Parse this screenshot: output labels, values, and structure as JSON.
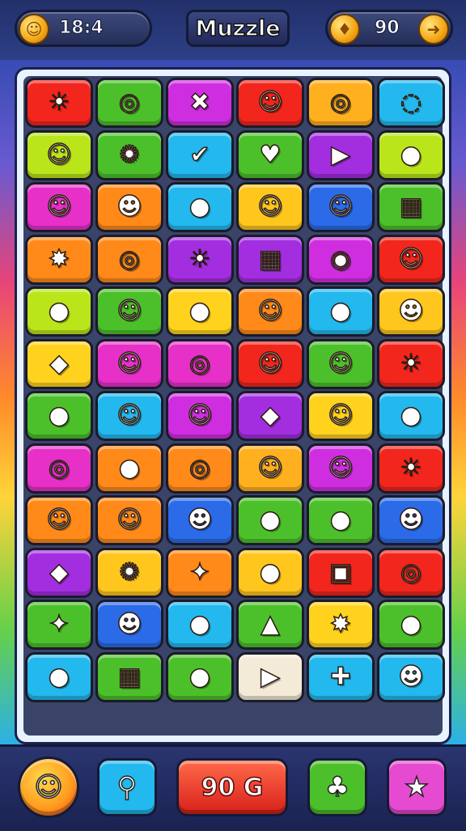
{
  "header": {
    "left_counter": "18:4",
    "title": "Muzzle",
    "right_counter": "90"
  },
  "board": {
    "rows": [
      [
        {
          "c": "#f2261d",
          "g": "☀"
        },
        {
          "c": "#4cc02a",
          "g": "◎"
        },
        {
          "c": "#cf2ee0",
          "g": "✖"
        },
        {
          "c": "#f2261d",
          "g": "☺"
        },
        {
          "c": "#ffb01e",
          "g": "◎"
        },
        {
          "c": "#23b8ee",
          "g": "◌"
        }
      ],
      [
        {
          "c": "#b9e51a",
          "g": "☺"
        },
        {
          "c": "#4cc02a",
          "g": "✺"
        },
        {
          "c": "#23b8ee",
          "g": "✔"
        },
        {
          "c": "#4cc02a",
          "g": "♥"
        },
        {
          "c": "#a22ee0",
          "g": "▶"
        },
        {
          "c": "#b9e51a",
          "g": "●"
        }
      ],
      [
        {
          "c": "#e630c8",
          "g": "☺"
        },
        {
          "c": "#ff8a1a",
          "g": "☻"
        },
        {
          "c": "#23b8ee",
          "g": "●"
        },
        {
          "c": "#ffc61e",
          "g": "☺"
        },
        {
          "c": "#2b6be8",
          "g": "☺"
        },
        {
          "c": "#4cc02a",
          "g": "▦"
        }
      ],
      [
        {
          "c": "#ff8a1a",
          "g": "✸"
        },
        {
          "c": "#ff8a1a",
          "g": "◎"
        },
        {
          "c": "#a22ee0",
          "g": "☀"
        },
        {
          "c": "#a22ee0",
          "g": "▦"
        },
        {
          "c": "#cf2ee0",
          "g": "◉"
        },
        {
          "c": "#f2261d",
          "g": "☺"
        }
      ],
      [
        {
          "c": "#b9e51a",
          "g": "●"
        },
        {
          "c": "#4cc02a",
          "g": "☺"
        },
        {
          "c": "#ffd21e",
          "g": "●"
        },
        {
          "c": "#ff8a1a",
          "g": "☺"
        },
        {
          "c": "#23b8ee",
          "g": "●"
        },
        {
          "c": "#ffc61e",
          "g": "☻"
        }
      ],
      [
        {
          "c": "#ffd21e",
          "g": "◆"
        },
        {
          "c": "#e630c8",
          "g": "☺"
        },
        {
          "c": "#e630c8",
          "g": "◎"
        },
        {
          "c": "#f2261d",
          "g": "☺"
        },
        {
          "c": "#4cc02a",
          "g": "☺"
        },
        {
          "c": "#f2261d",
          "g": "☀"
        }
      ],
      [
        {
          "c": "#4cc02a",
          "g": "●"
        },
        {
          "c": "#23b8ee",
          "g": "☺"
        },
        {
          "c": "#cf2ee0",
          "g": "☺"
        },
        {
          "c": "#a22ee0",
          "g": "◆"
        },
        {
          "c": "#ffd21e",
          "g": "☺"
        },
        {
          "c": "#23b8ee",
          "g": "●"
        }
      ],
      [
        {
          "c": "#e630c8",
          "g": "◎"
        },
        {
          "c": "#ff8a1a",
          "g": "●"
        },
        {
          "c": "#ff8a1a",
          "g": "◎"
        },
        {
          "c": "#ffb01e",
          "g": "☺"
        },
        {
          "c": "#cf2ee0",
          "g": "☺"
        },
        {
          "c": "#f2261d",
          "g": "☀"
        }
      ],
      [
        {
          "c": "#ff8a1a",
          "g": "☺"
        },
        {
          "c": "#ff8a1a",
          "g": "☺"
        },
        {
          "c": "#2b6be8",
          "g": "☻"
        },
        {
          "c": "#4cc02a",
          "g": "●"
        },
        {
          "c": "#4cc02a",
          "g": "●"
        },
        {
          "c": "#2b6be8",
          "g": "☻"
        }
      ],
      [
        {
          "c": "#a22ee0",
          "g": "◆"
        },
        {
          "c": "#ffc61e",
          "g": "✺"
        },
        {
          "c": "#ff8a1a",
          "g": "✦"
        },
        {
          "c": "#ffc61e",
          "g": "●"
        },
        {
          "c": "#f2261d",
          "g": "▣"
        },
        {
          "c": "#f2261d",
          "g": "◎"
        }
      ],
      [
        {
          "c": "#4cc02a",
          "g": "✦"
        },
        {
          "c": "#2b6be8",
          "g": "☻"
        },
        {
          "c": "#23b8ee",
          "g": "●"
        },
        {
          "c": "#4cc02a",
          "g": "▲"
        },
        {
          "c": "#ffd21e",
          "g": "✸"
        },
        {
          "c": "#4cc02a",
          "g": "●"
        }
      ],
      [
        {
          "c": "#23b8ee",
          "g": "●"
        },
        {
          "c": "#4cc02a",
          "g": "▦"
        },
        {
          "c": "#4cc02a",
          "g": "●"
        },
        {
          "c": "#f4ead8",
          "g": "▶"
        },
        {
          "c": "#23b8ee",
          "g": "✚"
        },
        {
          "c": "#23b8ee",
          "g": "☻"
        }
      ]
    ]
  },
  "footer": {
    "score": "90 G",
    "buttons": [
      {
        "name": "smiley-button",
        "color": "#ff9a1e",
        "icon": "☺"
      },
      {
        "name": "search-button",
        "color": "#23b8ee",
        "icon": "⚲"
      },
      {
        "name": "tree-button",
        "color": "#4cc02a",
        "icon": "♣"
      },
      {
        "name": "star-button",
        "color": "#e64ad0",
        "icon": "★"
      }
    ]
  }
}
